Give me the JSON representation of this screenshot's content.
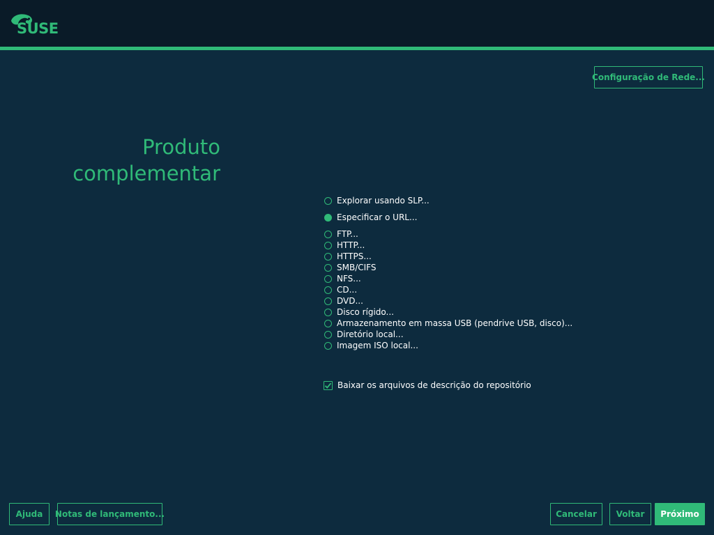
{
  "header": {
    "logo_text": "SUSE",
    "network_config_label": "Configuração de Rede..."
  },
  "page": {
    "title_line1": "Produto",
    "title_line2": "complementar"
  },
  "options": {
    "discovery": [
      {
        "label": "Explorar usando SLP...",
        "checked": false
      },
      {
        "label": "Especificar o URL...",
        "checked": true
      }
    ],
    "sources": [
      {
        "label": "FTP...",
        "checked": false
      },
      {
        "label": "HTTP...",
        "checked": false
      },
      {
        "label": "HTTPS...",
        "checked": false
      },
      {
        "label": "SMB/CIFS",
        "checked": false
      },
      {
        "label": "NFS...",
        "checked": false
      },
      {
        "label": "CD...",
        "checked": false
      },
      {
        "label": "DVD...",
        "checked": false
      },
      {
        "label": "Disco rígido...",
        "checked": false
      },
      {
        "label": "Armazenamento em massa USB (pendrive USB, disco)...",
        "checked": false
      },
      {
        "label": "Diretório local...",
        "checked": false
      },
      {
        "label": "Imagem ISO local...",
        "checked": false
      }
    ]
  },
  "download_checkbox": {
    "label": "Baixar os arquivos de descrição do repositório",
    "checked": true
  },
  "footer": {
    "help_label": "Ajuda",
    "release_notes_label": "Notas de lançamento...",
    "cancel_label": "Cancelar",
    "back_label": "Voltar",
    "next_label": "Próximo"
  },
  "colors": {
    "accent": "#30ba78",
    "background": "#0d2b3e",
    "topbar": "#0a1b28"
  }
}
